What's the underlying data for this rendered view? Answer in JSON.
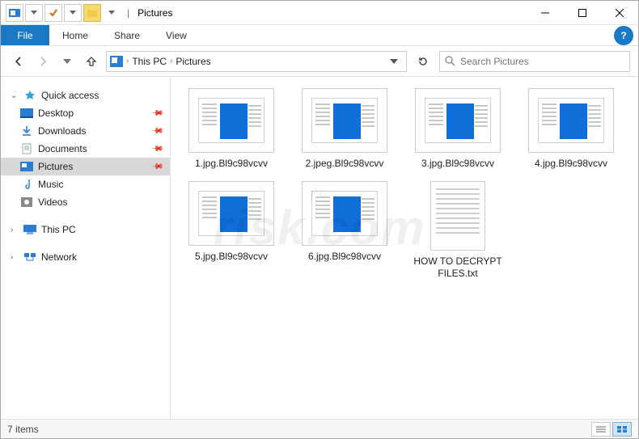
{
  "titlebar": {
    "separator": "|",
    "title": "Pictures"
  },
  "menubar": {
    "file": "File",
    "items": [
      "Home",
      "Share",
      "View"
    ],
    "help": "?"
  },
  "nav": {
    "breadcrumbs": [
      "This PC",
      "Pictures"
    ],
    "search_placeholder": "Search Pictures"
  },
  "sidebar": {
    "quick_access": "Quick access",
    "items": [
      {
        "label": "Desktop",
        "pinned": true
      },
      {
        "label": "Downloads",
        "pinned": true
      },
      {
        "label": "Documents",
        "pinned": true
      },
      {
        "label": "Pictures",
        "pinned": true,
        "selected": true
      },
      {
        "label": "Music",
        "pinned": false
      },
      {
        "label": "Videos",
        "pinned": false
      }
    ],
    "this_pc": "This PC",
    "network": "Network"
  },
  "files": [
    {
      "name": "1.jpg.Bl9c98vcvv",
      "type": "img"
    },
    {
      "name": "2.jpeg.Bl9c98vcvv",
      "type": "img"
    },
    {
      "name": "3.jpg.Bl9c98vcvv",
      "type": "img"
    },
    {
      "name": "4.jpg.Bl9c98vcvv",
      "type": "img"
    },
    {
      "name": "5.jpg.Bl9c98vcvv",
      "type": "img"
    },
    {
      "name": "6.jpg.Bl9c98vcvv",
      "type": "img"
    },
    {
      "name": "HOW TO DECRYPT FILES.txt",
      "type": "txt"
    }
  ],
  "status": {
    "count_label": "7 items"
  },
  "watermark": {
    "line1": "PC",
    "line2": "risk.com"
  }
}
